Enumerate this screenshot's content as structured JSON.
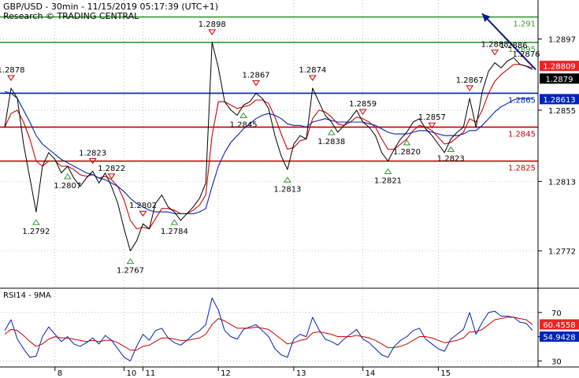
{
  "header": {
    "line1": "GBP/USD - 30min - 11/15/2019 05:17:39 (UTC+1)",
    "line2": "Research © TRADING CENTRAL"
  },
  "rsi_panel": {
    "label": "RSI14 - 9MA"
  },
  "colors": {
    "price": "#000000",
    "ma_red": "#cc0000",
    "ma_blue": "#0022bb",
    "resistance": "#339933",
    "support": "#cc0000",
    "pivot": "#0022bb",
    "arrow": "#0a1a8a",
    "grid": "#999999"
  },
  "chart_data": [
    {
      "type": "line",
      "name": "price",
      "title": "GBP/USD - 30min - 11/15/2019 05:17:39 (UTC+1)",
      "x_ticks": [
        "8",
        "10",
        "11",
        "12",
        "13",
        "14",
        "15"
      ],
      "y_ticks": [
        1.2772,
        1.2813,
        1.2855,
        1.2897
      ],
      "ylim": [
        1.275,
        1.292
      ],
      "levels": [
        {
          "value": 1.291,
          "label": "1.291",
          "kind": "resistance"
        },
        {
          "value": 1.2895,
          "label": "1.2895",
          "kind": "resistance"
        },
        {
          "value": 1.2865,
          "label": "1.2865",
          "kind": "pivot"
        },
        {
          "value": 1.2845,
          "label": "1.2845",
          "kind": "support"
        },
        {
          "value": 1.2825,
          "label": "1.2825",
          "kind": "support"
        }
      ],
      "tags": [
        {
          "label": "1.28809",
          "kind": "red"
        },
        {
          "label": "1.2879",
          "kind": "black"
        },
        {
          "label": "1.28613",
          "kind": "blue"
        }
      ],
      "series": [
        {
          "values": [
            1.2845,
            1.2868,
            1.2862,
            1.2835,
            1.2815,
            1.2795,
            1.2822,
            1.283,
            1.2826,
            1.2818,
            1.2822,
            1.2815,
            1.281,
            1.2815,
            1.2819,
            1.2812,
            1.2818,
            1.281,
            1.28,
            1.2785,
            1.2772,
            1.2778,
            1.2788,
            1.2785,
            1.28,
            1.2805,
            1.2798,
            1.2795,
            1.279,
            1.2794,
            1.2798,
            1.2803,
            1.2812,
            1.2895,
            1.288,
            1.286,
            1.2855,
            1.2852,
            1.2858,
            1.286,
            1.2865,
            1.2862,
            1.2856,
            1.284,
            1.2828,
            1.282,
            1.2835,
            1.284,
            1.2838,
            1.2868,
            1.286,
            1.2852,
            1.2848,
            1.2842,
            1.2846,
            1.285,
            1.2855,
            1.2848,
            1.2845,
            1.284,
            1.283,
            1.2825,
            1.2832,
            1.2838,
            1.2842,
            1.2848,
            1.285,
            1.2844,
            1.284,
            1.2835,
            1.283,
            1.2838,
            1.2842,
            1.2845,
            1.2862,
            1.2845,
            1.2866,
            1.2878,
            1.2883,
            1.288,
            1.2884,
            1.2886,
            1.2882,
            1.2881,
            1.2879
          ]
        },
        {
          "name": "MA red",
          "values": [
            1.2845,
            1.2853,
            1.2855,
            1.2848,
            1.2838,
            1.2825,
            1.2822,
            1.2825,
            1.2825,
            1.2822,
            1.2822,
            1.282,
            1.2817,
            1.2816,
            1.2817,
            1.2815,
            1.2816,
            1.2814,
            1.281,
            1.2802,
            1.279,
            1.2785,
            1.2786,
            1.2785,
            1.2791,
            1.2797,
            1.2797,
            1.2796,
            1.2794,
            1.2794,
            1.2796,
            1.2799,
            1.2805,
            1.284,
            1.286,
            1.286,
            1.2858,
            1.2856,
            1.2857,
            1.2858,
            1.2861,
            1.2861,
            1.2859,
            1.2851,
            1.2841,
            1.2832,
            1.2833,
            1.2837,
            1.2838,
            1.285,
            1.2855,
            1.2854,
            1.2851,
            1.2847,
            1.2846,
            1.2848,
            1.2851,
            1.285,
            1.2848,
            1.2845,
            1.2838,
            1.2832,
            1.2832,
            1.2835,
            1.2838,
            1.2843,
            1.2846,
            1.2845,
            1.2843,
            1.2839,
            1.2835,
            1.2836,
            1.2839,
            1.2842,
            1.285,
            1.2848,
            1.2855,
            1.2865,
            1.2872,
            1.2876,
            1.2879,
            1.2882,
            1.2882,
            1.2881,
            1.288
          ]
        },
        {
          "name": "MA blue",
          "values": [
            1.2866,
            1.2865,
            1.2862,
            1.2855,
            1.2848,
            1.284,
            1.2835,
            1.2832,
            1.2829,
            1.2826,
            1.2824,
            1.2822,
            1.282,
            1.2818,
            1.2817,
            1.2815,
            1.2814,
            1.2812,
            1.281,
            1.2807,
            1.2803,
            1.28,
            1.2798,
            1.2796,
            1.2795,
            1.2795,
            1.2795,
            1.2794,
            1.2794,
            1.2794,
            1.2794,
            1.2795,
            1.2797,
            1.281,
            1.2822,
            1.283,
            1.2836,
            1.284,
            1.2844,
            1.2847,
            1.285,
            1.2852,
            1.2853,
            1.2852,
            1.285,
            1.2847,
            1.2846,
            1.2846,
            1.2845,
            1.2848,
            1.2849,
            1.285,
            1.2849,
            1.2848,
            1.2848,
            1.2848,
            1.2848,
            1.2848,
            1.2847,
            1.2846,
            1.2844,
            1.2842,
            1.2841,
            1.2841,
            1.2841,
            1.2842,
            1.2843,
            1.2843,
            1.2842,
            1.2841,
            1.284,
            1.284,
            1.284,
            1.2841,
            1.2843,
            1.2843,
            1.2846,
            1.285,
            1.2854,
            1.2857,
            1.2859,
            1.2861,
            1.2862,
            1.2862,
            1.2862
          ]
        }
      ],
      "annotations": [
        {
          "i": 1,
          "label": "1.2878",
          "type": "high"
        },
        {
          "i": 5,
          "label": "1.2792",
          "type": "low"
        },
        {
          "i": 10,
          "label": "1.2807",
          "type": "low"
        },
        {
          "i": 14,
          "label": "1.2823",
          "type": "high"
        },
        {
          "i": 17,
          "label": "1.2822",
          "type": "high"
        },
        {
          "i": 20,
          "label": "1.2767",
          "type": "low"
        },
        {
          "i": 22,
          "label": "1.2802",
          "type": "high"
        },
        {
          "i": 27,
          "label": "1.2784",
          "type": "low"
        },
        {
          "i": 33,
          "label": "1.2898",
          "type": "high"
        },
        {
          "i": 38,
          "label": "1.2845",
          "type": "low"
        },
        {
          "i": 40,
          "label": "1.2867",
          "type": "high"
        },
        {
          "i": 45,
          "label": "1.2813",
          "type": "low"
        },
        {
          "i": 49,
          "label": "1.2874",
          "type": "high"
        },
        {
          "i": 52,
          "label": "1.2838",
          "type": "low"
        },
        {
          "i": 57,
          "label": "1.2859",
          "type": "high"
        },
        {
          "i": 61,
          "label": "1.2821",
          "type": "low"
        },
        {
          "i": 64,
          "label": "1.2820",
          "type": "low"
        },
        {
          "i": 68,
          "label": "1.2857",
          "type": "high"
        },
        {
          "i": 71,
          "label": "1.2823",
          "type": "low"
        },
        {
          "i": 74,
          "label": "1.2867",
          "type": "high"
        },
        {
          "i": 78,
          "label": "1.2888",
          "type": "high"
        },
        {
          "i": 81,
          "label": "1.2886",
          "type": "none"
        },
        {
          "i": 83,
          "label": "1.2876",
          "type": "none"
        }
      ],
      "projection": {
        "from_i": 84,
        "from_value": 1.2879,
        "to_value": 1.2912
      }
    },
    {
      "type": "line",
      "name": "RSI14 - 9MA",
      "y_ticks": [
        30,
        50,
        70
      ],
      "ylim": [
        25,
        90
      ],
      "tags": [
        {
          "label": "60.4558",
          "kind": "red"
        },
        {
          "label": "54.9428",
          "kind": "blue"
        }
      ],
      "series": [
        {
          "name": "RSI",
          "values": [
            55,
            64,
            48,
            40,
            33,
            34,
            50,
            58,
            52,
            46,
            50,
            44,
            42,
            45,
            49,
            44,
            51,
            47,
            40,
            33,
            30,
            42,
            52,
            47,
            55,
            57,
            49,
            45,
            43,
            47,
            52,
            55,
            60,
            82,
            72,
            55,
            50,
            48,
            56,
            58,
            60,
            55,
            50,
            40,
            35,
            33,
            48,
            52,
            50,
            66,
            56,
            48,
            46,
            43,
            48,
            52,
            56,
            48,
            45,
            40,
            35,
            33,
            42,
            47,
            50,
            55,
            57,
            48,
            44,
            40,
            38,
            48,
            52,
            56,
            70,
            52,
            62,
            70,
            71,
            67,
            67,
            66,
            62,
            61,
            55
          ]
        },
        {
          "name": "MA",
          "values": [
            52,
            56,
            55,
            51,
            46,
            42,
            44,
            48,
            50,
            49,
            49,
            48,
            47,
            46,
            47,
            46,
            47,
            47,
            45,
            42,
            39,
            39,
            42,
            43,
            46,
            49,
            49,
            48,
            47,
            47,
            48,
            49,
            52,
            60,
            65,
            63,
            60,
            57,
            57,
            57,
            58,
            57,
            56,
            52,
            48,
            44,
            45,
            47,
            48,
            53,
            54,
            53,
            52,
            50,
            50,
            50,
            51,
            50,
            49,
            47,
            44,
            41,
            41,
            42,
            44,
            47,
            50,
            50,
            49,
            47,
            45,
            46,
            47,
            49,
            54,
            54,
            56,
            60,
            64,
            65,
            66,
            66,
            65,
            64,
            60
          ]
        }
      ]
    }
  ]
}
